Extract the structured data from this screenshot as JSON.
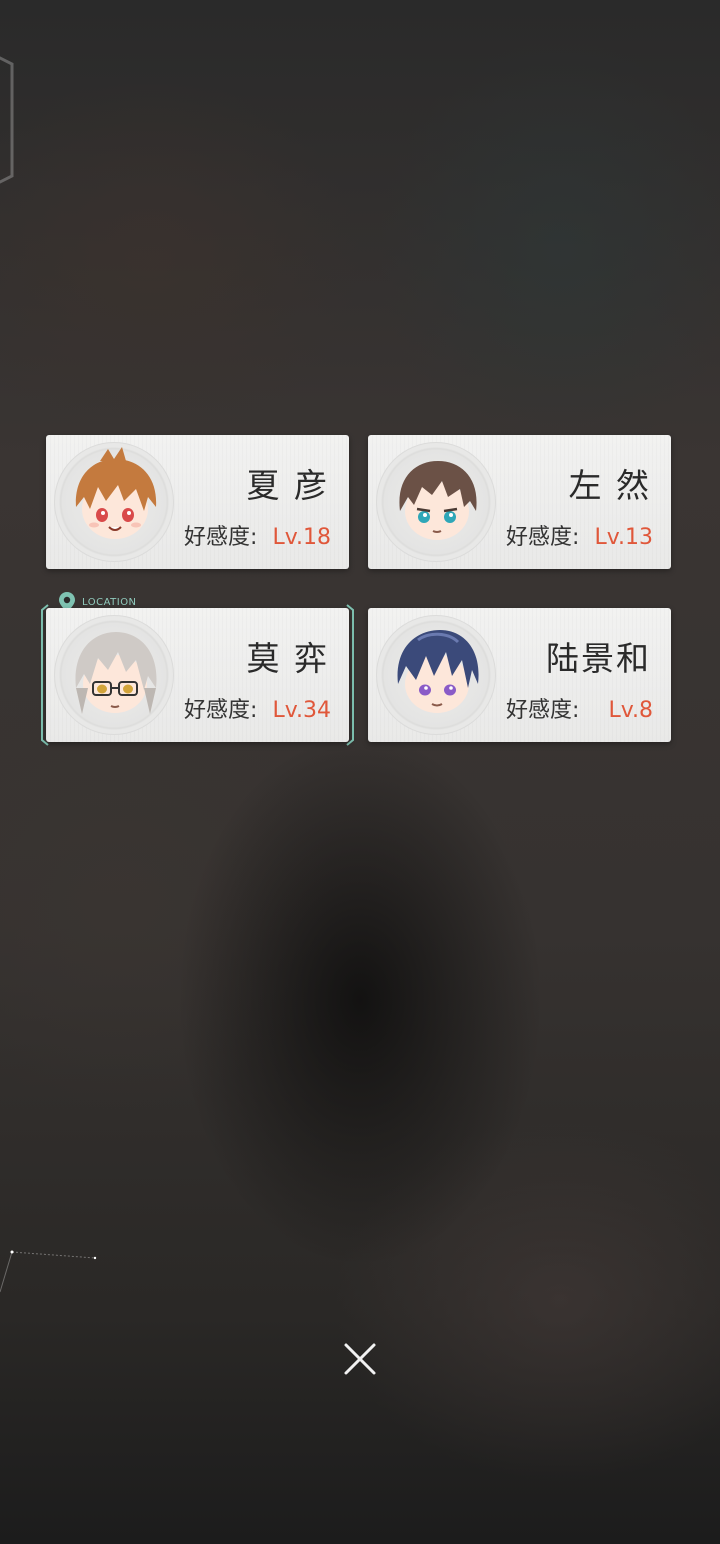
{
  "characters": [
    {
      "name": "夏 彦",
      "affinity_label": "好感度:",
      "level": "Lv.18",
      "avatar": "avatar-brown-hair-red-eyes",
      "hair_color": "#c47a3e",
      "eye_color": "#d94a4a"
    },
    {
      "name": "左 然",
      "affinity_label": "好感度:",
      "level": "Lv.13",
      "avatar": "avatar-dark-brown-hair-teal-eyes",
      "hair_color": "#6b5146",
      "eye_color": "#2fa7b8"
    },
    {
      "name": "莫 弈",
      "affinity_label": "好感度:",
      "level": "Lv.34",
      "avatar": "avatar-silver-hair-glasses",
      "hair_color": "#cfcac6",
      "eye_color": "#d2a43b"
    },
    {
      "name": "陆景和",
      "affinity_label": "好感度:",
      "level": "Lv.8",
      "avatar": "avatar-navy-hair-purple-eyes",
      "hair_color": "#3b4a7a",
      "eye_color": "#8a5bc7"
    }
  ],
  "location_label": "LOCATION",
  "icons": {
    "location": "location-pin-icon",
    "close": "close-icon"
  },
  "colors": {
    "level_accent": "#e0573a",
    "location_accent": "#7fc3b2",
    "card_bg": "#f0f0ef"
  }
}
